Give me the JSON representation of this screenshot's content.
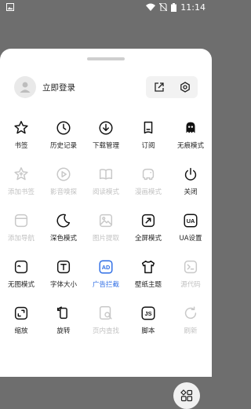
{
  "status": {
    "time": "11:14"
  },
  "account": {
    "login_label": "立即登录"
  },
  "colors": {
    "accent": "#2f6ee5",
    "icon": "#111111",
    "disabled": "#c8c8c8"
  },
  "menu_rows": [
    [
      {
        "label": "书签",
        "icon": "star-icon"
      },
      {
        "label": "历史记录",
        "icon": "clock-icon"
      },
      {
        "label": "下载管理",
        "icon": "download-icon"
      },
      {
        "label": "订阅",
        "icon": "subscribe-icon"
      },
      {
        "label": "无痕模式",
        "icon": "ghost-icon"
      }
    ],
    [
      {
        "label": "添加书签",
        "icon": "star-plus-icon",
        "disabled": true
      },
      {
        "label": "影音嗅探",
        "icon": "play-icon",
        "disabled": true
      },
      {
        "label": "阅读模式",
        "icon": "book-icon",
        "disabled": true
      },
      {
        "label": "漫画模式",
        "icon": "elephant-icon",
        "disabled": true
      },
      {
        "label": "关闭",
        "icon": "power-icon"
      }
    ],
    [
      {
        "label": "添加导航",
        "icon": "nav-icon",
        "disabled": true
      },
      {
        "label": "深色模式",
        "icon": "moon-icon"
      },
      {
        "label": "图片提取",
        "icon": "image-icon",
        "disabled": true
      },
      {
        "label": "全屏模式",
        "icon": "fullscreen-icon"
      },
      {
        "label": "UA设置",
        "icon": "ua-icon"
      }
    ],
    [
      {
        "label": "无图模式",
        "icon": "no-image-icon"
      },
      {
        "label": "字体大小",
        "icon": "font-size-icon"
      },
      {
        "label": "广告拦截",
        "icon": "ad-block-icon",
        "active": true
      },
      {
        "label": "壁纸主题",
        "icon": "shirt-icon"
      },
      {
        "label": "源代码",
        "icon": "terminal-icon",
        "disabled": true
      }
    ],
    [
      {
        "label": "缩放",
        "icon": "zoom-icon"
      },
      {
        "label": "旋转",
        "icon": "rotate-icon"
      },
      {
        "label": "页内查找",
        "icon": "find-icon",
        "disabled": true
      },
      {
        "label": "脚本",
        "icon": "js-icon"
      },
      {
        "label": "刷新",
        "icon": "refresh-icon",
        "disabled": true
      }
    ]
  ]
}
